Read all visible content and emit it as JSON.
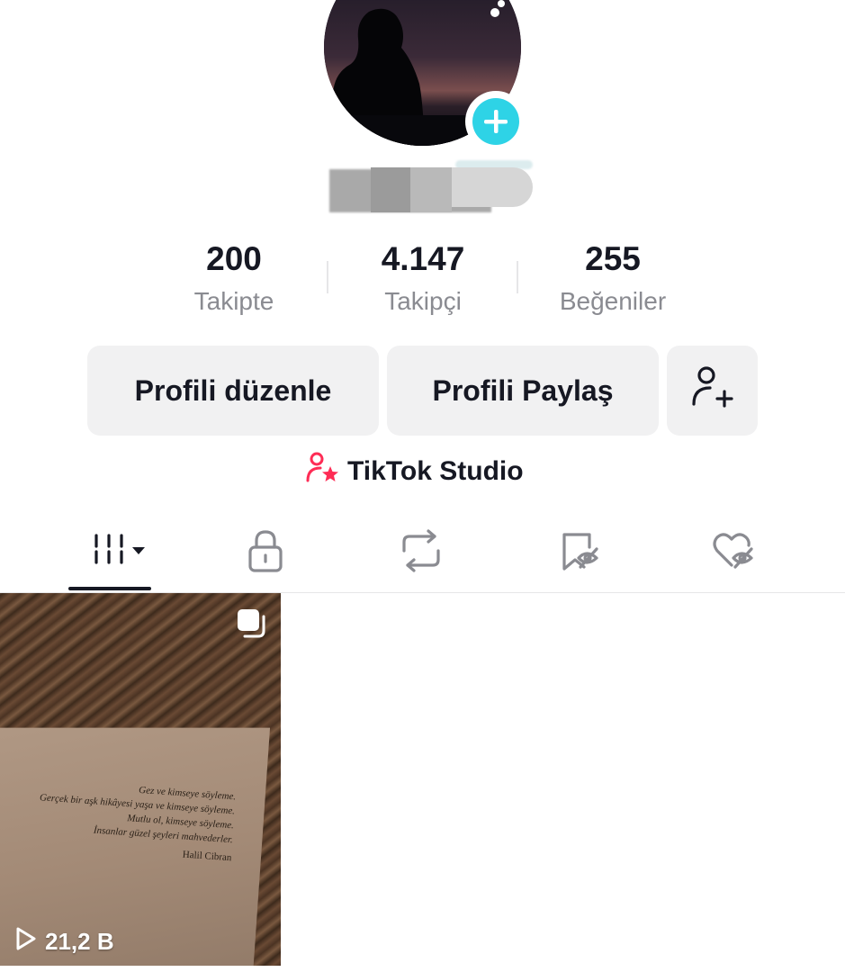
{
  "profile": {
    "stats": [
      {
        "value": "200",
        "label": "Takipte"
      },
      {
        "value": "4.147",
        "label": "Takipçi"
      },
      {
        "value": "255",
        "label": "Beğeniler"
      }
    ]
  },
  "actions": {
    "edit_profile": "Profili düzenle",
    "share_profile": "Profili Paylaş",
    "studio": "TikTok Studio"
  },
  "tabs": [
    {
      "icon": "videos-grid-icon",
      "active": true
    },
    {
      "icon": "lock-icon",
      "active": false
    },
    {
      "icon": "repost-icon",
      "active": false
    },
    {
      "icon": "bookmark-hidden-icon",
      "active": false
    },
    {
      "icon": "liked-hidden-icon",
      "active": false
    }
  ],
  "videos": [
    {
      "views": "21,2 B",
      "quote_lines": [
        "Gez ve kimseye söyleme.",
        "Gerçek bir aşk hikâyesi yaşa ve kimseye söyleme.",
        "Mutlu ol, kimseye söyleme.",
        "İnsanlar güzel şeyleri mahvederler."
      ],
      "quote_author": "Halil Cibran"
    }
  ],
  "colors": {
    "accent_cyan": "#2ed3e6",
    "studio_pink": "#fe2c55",
    "button_bg": "#f1f1f2",
    "muted_text": "#8a8b91"
  }
}
